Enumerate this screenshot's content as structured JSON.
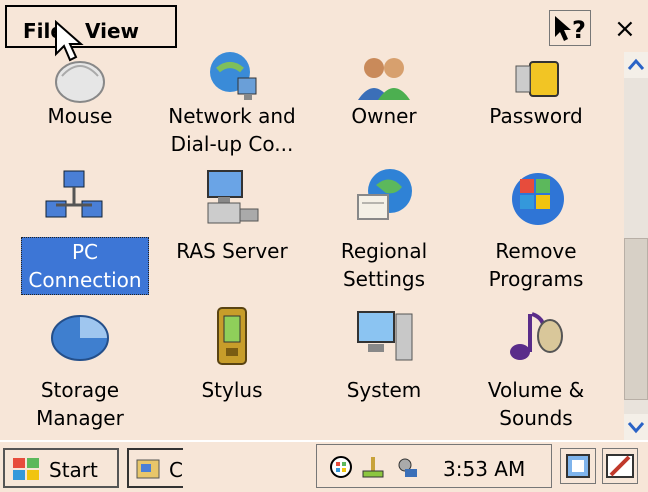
{
  "menubar": {
    "file_label": "File",
    "view_label": "View",
    "help_symbol": "?",
    "close_symbol": "×"
  },
  "items": [
    {
      "label": "Mouse",
      "icon": "mouse-icon"
    },
    {
      "label": "Network and\nDial-up Co...",
      "icon": "network-icon"
    },
    {
      "label": "Owner",
      "icon": "owner-icon"
    },
    {
      "label": "Password",
      "icon": "password-icon"
    },
    {
      "label": "PC\nConnection",
      "icon": "pc-connection-icon",
      "selected": true
    },
    {
      "label": "RAS Server",
      "icon": "ras-server-icon"
    },
    {
      "label": "Regional\nSettings",
      "icon": "regional-settings-icon"
    },
    {
      "label": "Remove\nPrograms",
      "icon": "remove-programs-icon"
    },
    {
      "label": "Storage\nManager",
      "icon": "storage-manager-icon"
    },
    {
      "label": "Stylus",
      "icon": "stylus-icon"
    },
    {
      "label": "System",
      "icon": "system-icon"
    },
    {
      "label": "Volume &\nSounds",
      "icon": "volume-sounds-icon"
    }
  ],
  "taskbar": {
    "start_label": "Start",
    "task_label": "C",
    "clock": "3:53 AM"
  },
  "colors": {
    "background": "#f7e6d8",
    "selection": "#3d76d6"
  }
}
